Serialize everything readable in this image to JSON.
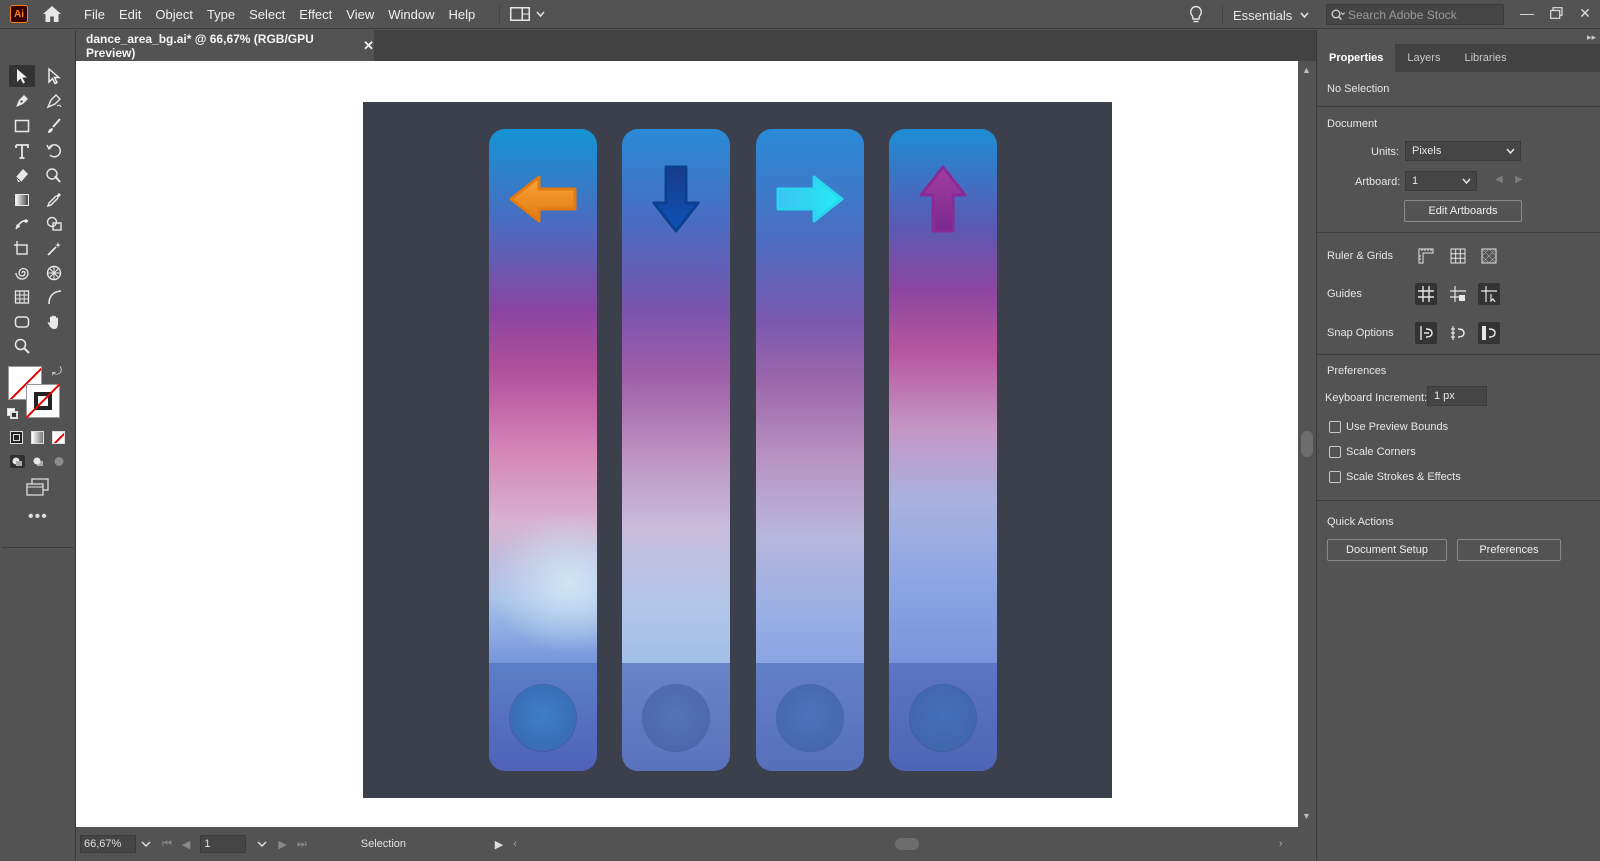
{
  "app": {
    "logo_text": "Ai",
    "menus": [
      "File",
      "Edit",
      "Object",
      "Type",
      "Select",
      "Effect",
      "View",
      "Window",
      "Help"
    ],
    "workspace": "Essentials",
    "stock_search_placeholder": "Search Adobe Stock"
  },
  "document": {
    "tab_title": "dance_area_bg.ai* @ 66,67% (RGB/GPU Preview)"
  },
  "artwork": {
    "lanes": [
      {
        "arrow": "left-arrow",
        "arrow_color": "#f08a1e",
        "top_color": "#1594d4"
      },
      {
        "arrow": "down-arrow",
        "arrow_color": "#0b3f8f",
        "top_color": "#2a8ad6"
      },
      {
        "arrow": "right-arrow",
        "arrow_color": "#2ad5f0",
        "top_color": "#2a8ad6"
      },
      {
        "arrow": "up-arrow",
        "arrow_color": "#8a2a98",
        "top_color": "#1d8dd4"
      }
    ],
    "artboard_color": "#3c3f4c"
  },
  "status": {
    "zoom": "66,67%",
    "artboard_number": "1",
    "current_tool": "Selection"
  },
  "properties_panel": {
    "tabs": [
      "Properties",
      "Layers",
      "Libraries"
    ],
    "active_tab": "Properties",
    "selection_state": "No Selection",
    "document_heading": "Document",
    "units_label": "Units:",
    "units_value": "Pixels",
    "artboard_label": "Artboard:",
    "artboard_value": "1",
    "edit_artboards_button": "Edit Artboards",
    "ruler_grids_label": "Ruler & Grids",
    "guides_label": "Guides",
    "snap_options_label": "Snap Options",
    "preferences_heading": "Preferences",
    "keyboard_increment_label": "Keyboard Increment:",
    "keyboard_increment_value": "1 px",
    "checkboxes": [
      "Use Preview Bounds",
      "Scale Corners",
      "Scale Strokes & Effects"
    ],
    "quick_actions_heading": "Quick Actions",
    "document_setup_button": "Document Setup",
    "preferences_button": "Preferences"
  }
}
